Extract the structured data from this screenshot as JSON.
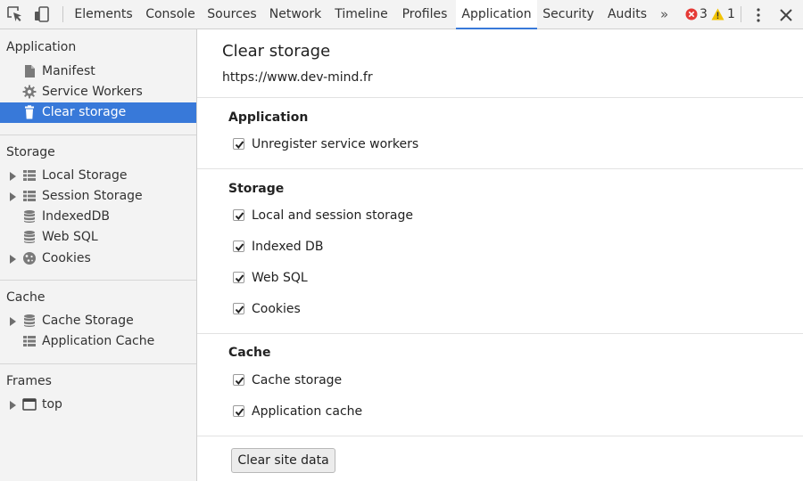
{
  "toolbar": {
    "tabs": [
      {
        "label": "Elements"
      },
      {
        "label": "Console"
      },
      {
        "label": "Sources"
      },
      {
        "label": "Network"
      },
      {
        "label": "Timeline"
      },
      {
        "label": "Profiles"
      },
      {
        "label": "Application",
        "selected": true
      },
      {
        "label": "Security"
      },
      {
        "label": "Audits"
      }
    ],
    "overflow_label": "»",
    "error_count": "3",
    "warning_count": "1",
    "icons": {
      "inspect": "inspect-element-icon",
      "device": "device-toolbar-icon",
      "error": "error-icon",
      "warning": "warning-icon",
      "menu": "more-vertical-icon",
      "close": "close-icon"
    },
    "colors": {
      "error": "#e53935",
      "warning": "#f2c300",
      "accent": "#3879d9"
    }
  },
  "sidebar": {
    "sections": [
      {
        "title": "Application",
        "items": [
          {
            "label": "Manifest",
            "icon": "document-icon"
          },
          {
            "label": "Service Workers",
            "icon": "gear-icon"
          },
          {
            "label": "Clear storage",
            "icon": "trash-icon",
            "selected": true
          }
        ]
      },
      {
        "title": "Storage",
        "items": [
          {
            "label": "Local Storage",
            "icon": "grid-icon",
            "expandable": true
          },
          {
            "label": "Session Storage",
            "icon": "grid-icon",
            "expandable": true
          },
          {
            "label": "IndexedDB",
            "icon": "database-icon"
          },
          {
            "label": "Web SQL",
            "icon": "database-icon"
          },
          {
            "label": "Cookies",
            "icon": "cookie-icon",
            "expandable": true
          }
        ]
      },
      {
        "title": "Cache",
        "items": [
          {
            "label": "Cache Storage",
            "icon": "database-icon",
            "expandable": true
          },
          {
            "label": "Application Cache",
            "icon": "grid-icon"
          }
        ]
      },
      {
        "title": "Frames",
        "items": [
          {
            "label": "top",
            "icon": "frame-icon",
            "expandable": true
          }
        ]
      }
    ]
  },
  "main": {
    "title": "Clear storage",
    "origin": "https://www.dev-mind.fr",
    "groups": [
      {
        "title": "Application",
        "options": [
          {
            "label": "Unregister service workers",
            "checked": true
          }
        ]
      },
      {
        "title": "Storage",
        "options": [
          {
            "label": "Local and session storage",
            "checked": true
          },
          {
            "label": "Indexed DB",
            "checked": true
          },
          {
            "label": "Web SQL",
            "checked": true
          },
          {
            "label": "Cookies",
            "checked": true
          }
        ]
      },
      {
        "title": "Cache",
        "options": [
          {
            "label": "Cache storage",
            "checked": true
          },
          {
            "label": "Application cache",
            "checked": true
          }
        ]
      }
    ],
    "clear_button_label": "Clear site data"
  }
}
